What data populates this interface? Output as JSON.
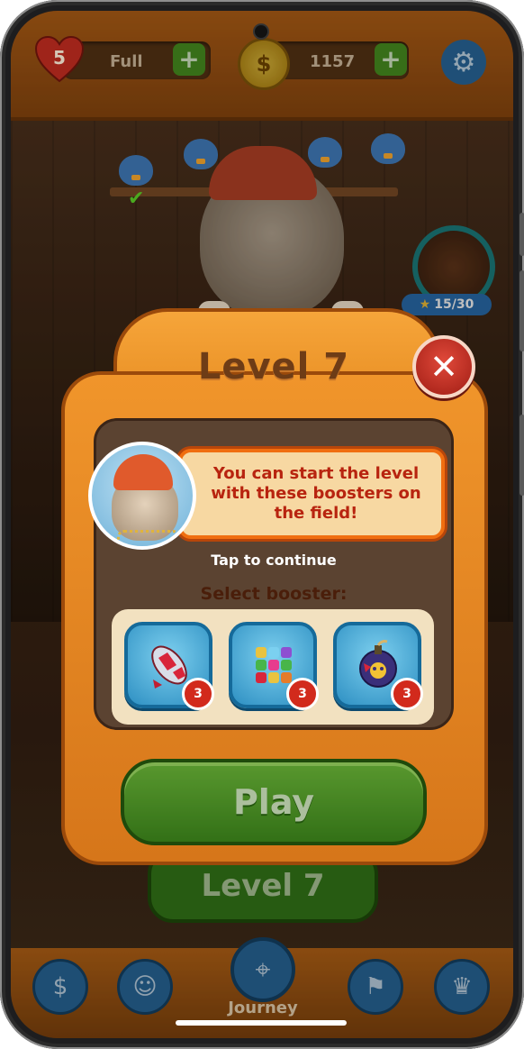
{
  "hud": {
    "lives": "5",
    "lives_status": "Full",
    "coins": "1157"
  },
  "background": {
    "chest_progress": "15/30",
    "level_button": "Level 7"
  },
  "modal": {
    "title": "Level 7",
    "tip_text": "You can start the level with these boosters on the field!",
    "tap_continue": "Tap to continue",
    "select_label": "Select booster:",
    "boosters": [
      {
        "name": "rocket",
        "count": "3"
      },
      {
        "name": "rubik-cube",
        "count": "3"
      },
      {
        "name": "bomb",
        "count": "3"
      }
    ],
    "play_label": "Play"
  },
  "nav": {
    "active_label": "Journey"
  },
  "colors": {
    "modal_orange": "#e58a1f",
    "play_green": "#4f9e23",
    "close_red": "#c8301f",
    "tip_text_red": "#b8240f",
    "nav_blue": "#2c6fa6"
  }
}
